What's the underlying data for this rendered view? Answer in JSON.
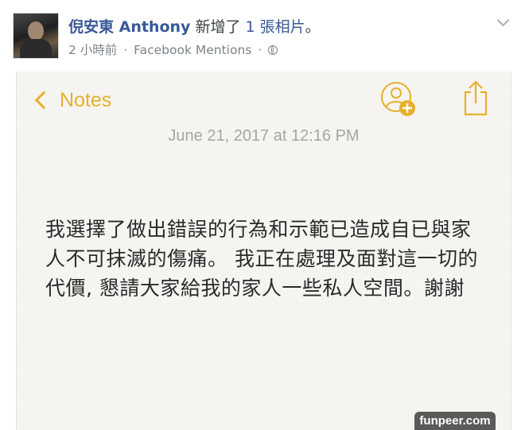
{
  "post": {
    "author": "倪安東 Anthony",
    "action_prefix": "新增了",
    "photo_count": "1 張相片",
    "action_suffix": "。",
    "time": "2 小時前",
    "separator": "·",
    "source": "Facebook Mentions",
    "privacy_icon": "globe-icon",
    "menu_icon": "chevron-down-icon"
  },
  "note": {
    "back_label": "Notes",
    "date": "June 21, 2017 at 12:16 PM",
    "body": "我選擇了做出錯誤的行為和示範已造成自已與家人不可抹滅的傷痛。 我正在處理及面對這一切的代價, 懇請大家給我的家人一些私人空間。謝謝",
    "accent_color": "#e5b12d"
  },
  "watermark": "funpeer.com"
}
